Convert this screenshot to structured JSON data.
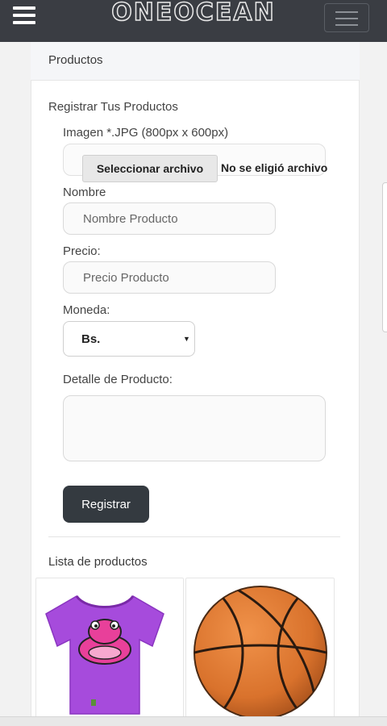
{
  "header": {
    "brand": "ONEOCEAN",
    "left_menu_icon": "hamburger-menu-icon",
    "right_menu_icon": "navbar-toggler-icon"
  },
  "panel": {
    "title": "Productos"
  },
  "form": {
    "heading": "Registrar Tus Productos",
    "image_label": "Imagen *.JPG (800px x 600px)",
    "file_button": "Seleccionar archivo",
    "file_status": "No se eligió archivo",
    "name_label": "Nombre",
    "name_placeholder": "Nombre Producto",
    "price_label": "Precio:",
    "price_placeholder": "Precio Producto",
    "currency_label": "Moneda:",
    "currency_value": "Bs.",
    "detail_label": "Detalle de Producto:",
    "detail_value": "",
    "submit_label": "Registrar"
  },
  "products": {
    "title": "Lista de productos",
    "items": [
      {
        "image": "purple-tshirt-image"
      },
      {
        "image": "basketball-image"
      }
    ]
  },
  "colors": {
    "navbar": "#3a3d43",
    "button_dark": "#343a40",
    "tshirt": "#a64bdc",
    "basketball": "#d9722c"
  }
}
